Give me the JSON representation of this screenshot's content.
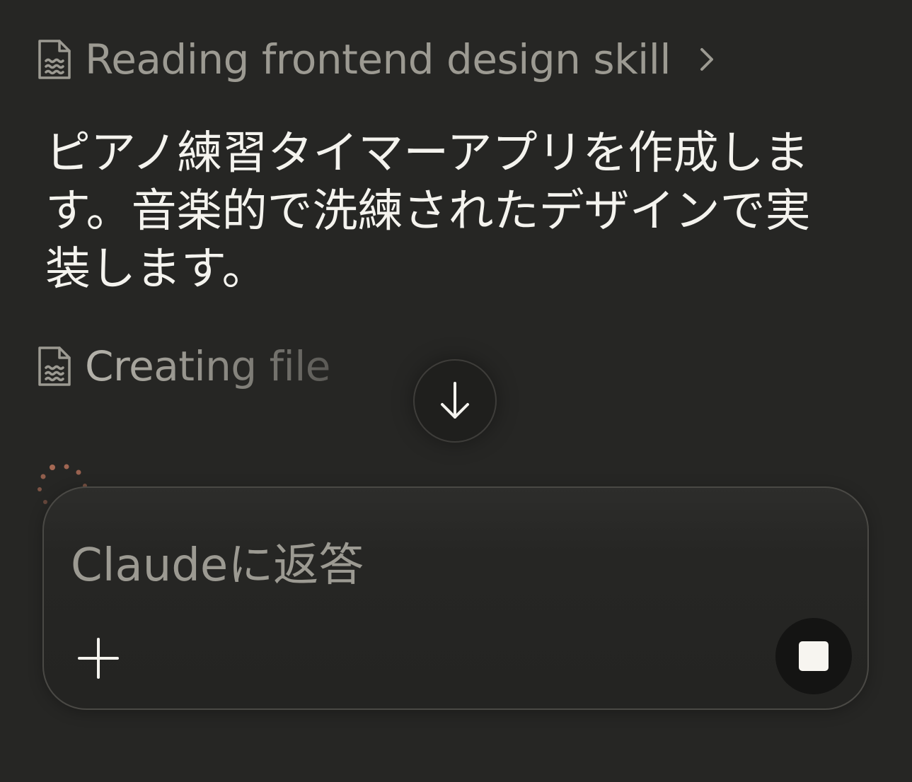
{
  "steps": {
    "reading": {
      "label": "Reading frontend design skill",
      "icon": "document-icon",
      "expand_icon": "chevron-right-icon"
    },
    "creating": {
      "label": "Creating file",
      "icon": "document-icon"
    }
  },
  "message": {
    "text": "ピアノ練習タイマーアプリを作成します。音楽的で洗練されたデザインで実装します。"
  },
  "scroll_button": {
    "icon": "arrow-down-icon"
  },
  "spinner": {
    "icon": "loading-spinner-icon",
    "color": "#b5715a"
  },
  "composer": {
    "placeholder": "Claudeに返答",
    "add_icon": "plus-icon",
    "stop_icon": "stop-icon"
  },
  "colors": {
    "background": "#262624",
    "text_primary": "#f4f3ee",
    "text_muted": "#9c9a92",
    "accent": "#b5715a"
  }
}
